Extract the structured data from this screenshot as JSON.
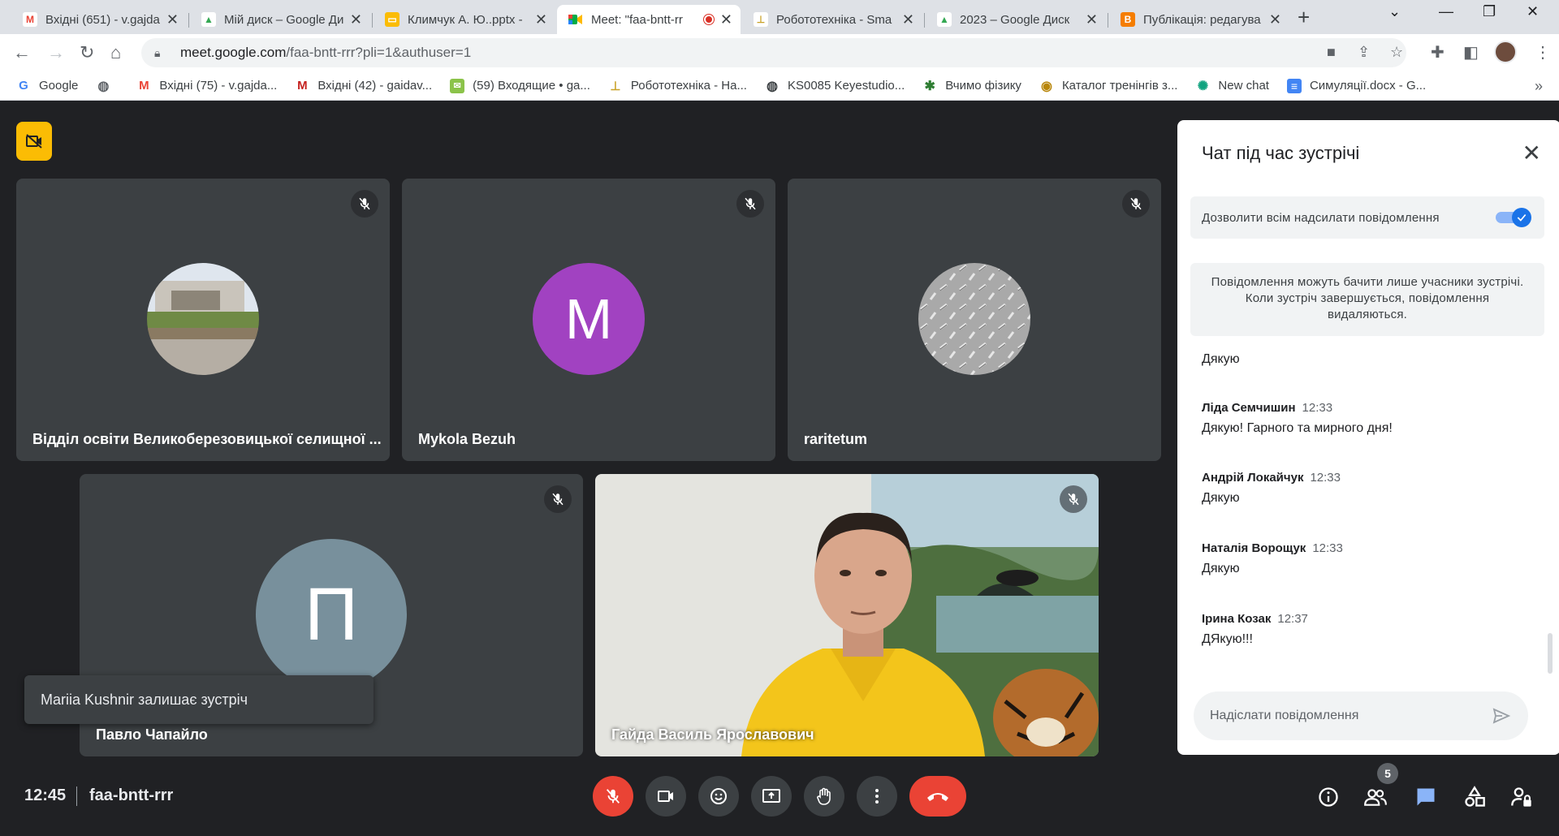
{
  "browser": {
    "tabs": [
      {
        "title": "Вхідні (651) - v.gajda@",
        "icon": "gmail-icon",
        "color": "#ea4335",
        "letter": "M"
      },
      {
        "title": "Мій диск – Google Ди",
        "icon": "drive-icon",
        "color": "#34a853",
        "letter": "▲"
      },
      {
        "title": "Климчук А. Ю..pptx -",
        "icon": "slides-icon",
        "color": "#fbbc04",
        "letter": "▭"
      },
      {
        "title": "Meet: \"faa-bntt-rr",
        "icon": "meet-icon",
        "color": "#00832d",
        "letter": "▶"
      },
      {
        "title": "Робототехніка - Sma",
        "icon": "doc-icon",
        "color": "#c9a227",
        "letter": "⊥"
      },
      {
        "title": "2023 – Google Диск",
        "icon": "drive-icon",
        "color": "#34a853",
        "letter": "▲"
      },
      {
        "title": "Публікація: редагува",
        "icon": "blogger-icon",
        "color": "#f57d00",
        "letter": "B"
      }
    ],
    "url_host": "meet.google.com",
    "url_path": "/faa-bntt-rrr?pli=1&authuser=1",
    "bookmarks": [
      {
        "label": "Google",
        "icon": "google-icon",
        "color": "#4285f4",
        "letter": "G"
      },
      {
        "label": "",
        "icon": "globe-icon",
        "color": "#5f6368",
        "letter": "◍"
      },
      {
        "label": "Вхідні (75) - v.gajda...",
        "icon": "gmail-icon",
        "color": "#ea4335",
        "letter": "M"
      },
      {
        "label": "Вхідні (42) - gaidav...",
        "icon": "gmail-icon",
        "color": "#c5221f",
        "letter": "M"
      },
      {
        "label": "(59) Входящие • ga...",
        "icon": "mail-icon",
        "color": "#8bc34a",
        "letter": "✉"
      },
      {
        "label": "Робототехніка - На...",
        "icon": "doc-icon",
        "color": "#c9a227",
        "letter": "⊥"
      },
      {
        "label": "KS0085 Keyestudio...",
        "icon": "globe-icon",
        "color": "#3c4043",
        "letter": "◍"
      },
      {
        "label": "Вчимо фізику",
        "icon": "physics-icon",
        "color": "#2e7d32",
        "letter": "✱"
      },
      {
        "label": "Каталог тренінгів з...",
        "icon": "catalog-icon",
        "color": "#b8860b",
        "letter": "◉"
      },
      {
        "label": "New chat",
        "icon": "chatgpt-icon",
        "color": "#10a37f",
        "letter": "✺"
      },
      {
        "label": "Симуляції.docx - G...",
        "icon": "docs-icon",
        "color": "#4285f4",
        "letter": "≡"
      }
    ]
  },
  "meet": {
    "tiles": [
      {
        "name": "Відділ освіти Великоберезовицької селищної ...",
        "type": "photo"
      },
      {
        "name": "Mykola Bezuh",
        "type": "letter",
        "letter": "M",
        "color": "#a142c1"
      },
      {
        "name": "raritetum",
        "type": "photo"
      },
      {
        "name": "Павло Чапайло",
        "type": "letter",
        "letter": "П",
        "color": "#78909c"
      },
      {
        "name": "Гайда Василь Ярославович",
        "type": "video"
      }
    ],
    "toast": "Mariia Kushnir залишає зустріч",
    "time": "12:45",
    "meeting_code": "faa-bntt-rrr",
    "participant_count": "5"
  },
  "chat": {
    "title": "Чат під час зустрічі",
    "permission_label": "Дозволити всім надсилати повідомлення",
    "permission_enabled": true,
    "info": "Повідомлення можуть бачити лише учасники зустрічі. Коли зустріч завершується, повідомлення видаляються.",
    "messages": [
      {
        "author": "",
        "time": "",
        "text": "Дякую"
      },
      {
        "author": "Ліда Семчишин",
        "time": "12:33",
        "text": "Дякую! Гарного та мирного дня!"
      },
      {
        "author": "Андрій Локайчук",
        "time": "12:33",
        "text": "Дякую"
      },
      {
        "author": "Наталія Ворощук",
        "time": "12:33",
        "text": "Дякую"
      },
      {
        "author": "Ірина Козак",
        "time": "12:37",
        "text": "ДЯкую!!!"
      }
    ],
    "input_placeholder": "Надіслати повідомлення"
  }
}
